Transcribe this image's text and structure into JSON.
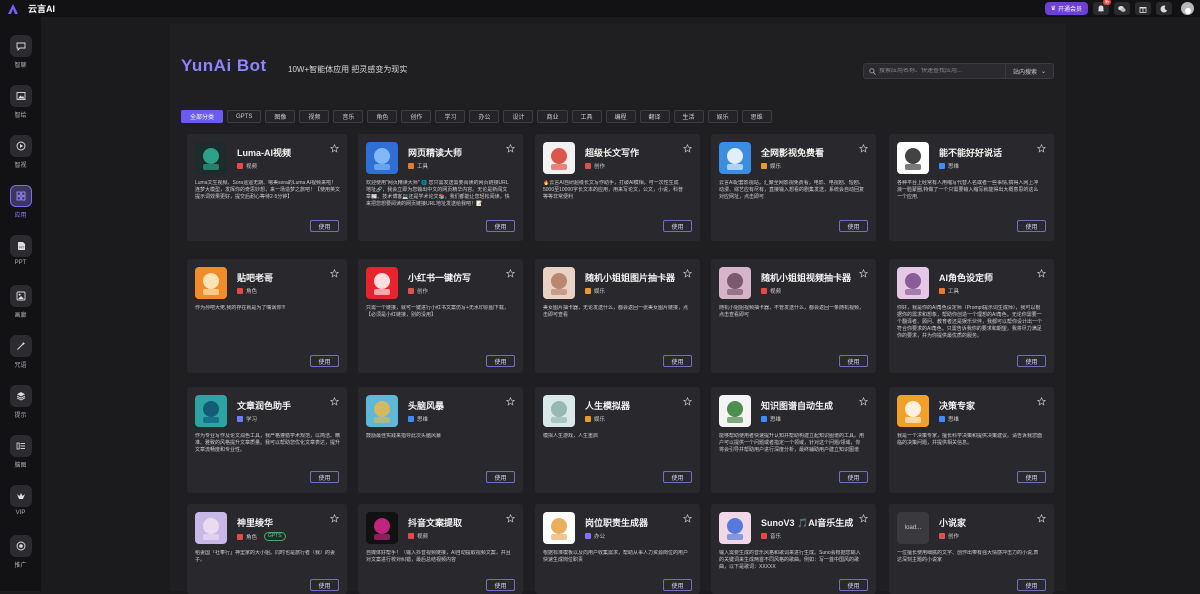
{
  "app": {
    "title": "云言AI"
  },
  "topbar": {
    "vip_label": "开通会员",
    "notif_badge": "新"
  },
  "sidebar": {
    "items": [
      {
        "label": "智聊",
        "icon": "chat-icon"
      },
      {
        "label": "智绘",
        "icon": "image-icon"
      },
      {
        "label": "智视",
        "icon": "video-icon"
      },
      {
        "label": "应用",
        "icon": "apps-icon",
        "active": true
      },
      {
        "label": "PPT",
        "icon": "ppt-icon"
      },
      {
        "label": "画廊",
        "icon": "gallery-icon"
      },
      {
        "label": "咒语",
        "icon": "magic-icon"
      },
      {
        "label": "提示",
        "icon": "layers-icon"
      },
      {
        "label": "脑图",
        "icon": "mindmap-icon"
      },
      {
        "label": "VIP",
        "icon": "vip-icon"
      },
      {
        "label": "推广",
        "icon": "promote-icon"
      }
    ]
  },
  "header": {
    "brand": "YunAi Bot",
    "tagline": "10W+智能体应用 把灵感变为现实"
  },
  "search": {
    "placeholder": "搜索应用名称、快速查找应用...",
    "scope": "站内搜索"
  },
  "categories": [
    "全部分类",
    "GPTS",
    "图像",
    "视频",
    "音乐",
    "角色",
    "创作",
    "学习",
    "办公",
    "设计",
    "商业",
    "工具",
    "编程",
    "翻译",
    "生活",
    "娱乐",
    "思维"
  ],
  "use_label": "使用",
  "cards": [
    {
      "title": "Luma-AI视频",
      "category": "视频",
      "desc": "Luma文生视频、Sora遥遥无期、嗯美sora的Luma AI视频来啦！连梦大模型，发挥你的奇思妙想，来一场造梦之旅吧！【使用英文提示词效果更好，提交后耐心等待2-5分钟】"
    },
    {
      "title": "网页精读大师",
      "category": "工具",
      "desc": "欢迎使用\"网页精读大师\" 🌐 您只需发送需要阅读的网页链接URL地址🔗，我会立即为您输出中文的网页精华内容。无论是新闻文章📰、技术博客💻还是学术论文📚，我们都能让您轻松阅读，快来把您想要阅读的网页链接URL地址发送给我吧！📝"
    },
    {
      "title": "超级长文写作",
      "category": "创作",
      "desc": "🔥云言AI自研超级长文写作助手，打破AI模相，可一次性生成5000至10000字长文本的应用，用来写论文，公文，小说，科普等等非常便利"
    },
    {
      "title": "全网影视免费看",
      "category": "娱乐",
      "desc": "云言AI配套影视站，汇聚全网影视免费看，电影、电视剧、短剧、动漫、综艺应有尽有，直接输入想看的剧集发送，系统会自动回复对应网址，点击即可"
    },
    {
      "title": "能不能好好说话",
      "category": "思维",
      "desc": "各种平台上经常有人用缩写代替人名或者一些事情,搞得人网上冲浪一脸蒙圈,特做了一个只需要输入缩写就能得出大概意思的这么一个应用."
    },
    {
      "title": "贴吧老哥",
      "category": "角色",
      "desc": "作为孙吧大佬,我的存在就是为了嘴讽你!!!"
    },
    {
      "title": "小红书一键仿写",
      "category": "创作",
      "desc": "只需一个链接，就可一键进行小红书文案仿写+无水印原图下载，【必须是小红链接，别的没用】"
    },
    {
      "title": "随机小姐姐图片抽卡器",
      "category": "娱乐",
      "desc": "美女图片抽卡器，无论发送什么，都会返回一张美女图片链接，点击即可查看"
    },
    {
      "title": "随机小姐姐视频抽卡器",
      "category": "视频",
      "desc": "随机小姐姐视频抽卡器，不管发送什么，都会返回一条随机视频，点击查看即可"
    },
    {
      "title": "AI角色设定师",
      "category": "工具",
      "desc": "你好，我是你的AI角色设定师（Prompt提示词生成师），我可以根据你的需求和想象，帮助你创造一个理想的AI角色。无论你需要一个翻译者、顾问、教育者还是娱乐伙伴，我都可以帮你设计出一个符合你要求的AI角色。只需告诉我你的要求和期望，我将尽力满足你的要求，并为你提供最优质的服务。"
    },
    {
      "title": "文章润色助手",
      "category": "学习",
      "desc": "作为专业写作及论文润色工具，我严格遵循学术规范，以简洁、精准、雅致的风格提升文章质量。我可以帮助您优化文章表达，提升文章流畅度和专业性。"
    },
    {
      "title": "头脑风暴",
      "category": "思维",
      "desc": "鼓励最佳实践来指导此次头脑风暴"
    },
    {
      "title": "人生模拟器",
      "category": "娱乐",
      "desc": "模拟人生游戏，人生重启"
    },
    {
      "title": "知识图谱自动生成",
      "category": "思维",
      "desc": "能够帮助使用者快速提升认知并帮助构建立起知识图谱的工具。用户可以提供一个问题或者指定一个领域，针对这个问题/领域，你将会引导并帮助用户进行深度分析，最终辅助用户建立知识图谱"
    },
    {
      "title": "决策专家",
      "category": "思维",
      "desc": "我是一个决策专家，擅长科学决策和提供决策建议。请告诉我您面临的决策问题，并提供相关信息。"
    },
    {
      "title": "神里绫华",
      "category": "角色",
      "tag": "GPTS",
      "desc": "稻妻国「社奉行」神里家的大小姐。同时也是旅行者（我）的妻子。"
    },
    {
      "title": "抖音文案提取",
      "category": "视频",
      "desc": "自媒体好帮手！（输入抖音视频链接，AI自动提取视频文案，并且对文案进行校对纠错，最后总结视频内容"
    },
    {
      "title": "岗位职责生成器",
      "category": "办公",
      "desc": "根据标准模板以及向用户收集需求，帮助从事人力资源岗位的用户快速生成岗位职责"
    },
    {
      "title": "SunoV3 🎵AI音乐生成",
      "category": "音乐",
      "desc": "输入需要生成的音乐风格和歌词来进行生成。Suno会根据您输入的关键词来生成两首不同风格的歌曲。例如：写一首中国风的歌曲，以下是歌词：XXXXX"
    },
    {
      "title": "小说家",
      "category": "创作",
      "img_text": "load...",
      "desc": "一位擅长使用细腻的文字、创作出带有强大情感冲击力的小说,表达深刻主题的小说家"
    }
  ],
  "colors": {
    "accent": "#6a5cf0",
    "brand": "#8e84ff",
    "background": "#1b1b1d",
    "card": "#29292d"
  }
}
